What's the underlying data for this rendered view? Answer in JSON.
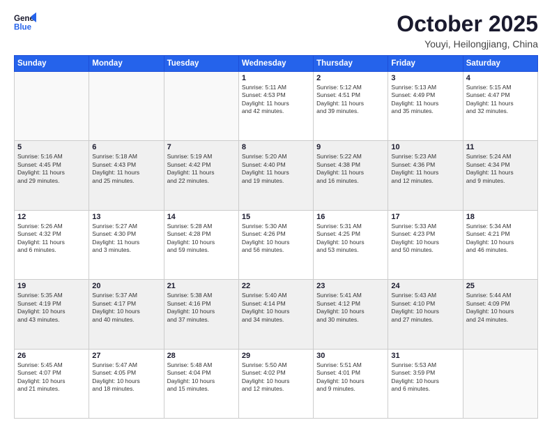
{
  "logo": {
    "line1": "General",
    "line2": "Blue"
  },
  "header": {
    "month": "October 2025",
    "location": "Youyi, Heilongjiang, China"
  },
  "weekdays": [
    "Sunday",
    "Monday",
    "Tuesday",
    "Wednesday",
    "Thursday",
    "Friday",
    "Saturday"
  ],
  "weeks": [
    [
      {
        "day": "",
        "info": ""
      },
      {
        "day": "",
        "info": ""
      },
      {
        "day": "",
        "info": ""
      },
      {
        "day": "1",
        "info": "Sunrise: 5:11 AM\nSunset: 4:53 PM\nDaylight: 11 hours\nand 42 minutes."
      },
      {
        "day": "2",
        "info": "Sunrise: 5:12 AM\nSunset: 4:51 PM\nDaylight: 11 hours\nand 39 minutes."
      },
      {
        "day": "3",
        "info": "Sunrise: 5:13 AM\nSunset: 4:49 PM\nDaylight: 11 hours\nand 35 minutes."
      },
      {
        "day": "4",
        "info": "Sunrise: 5:15 AM\nSunset: 4:47 PM\nDaylight: 11 hours\nand 32 minutes."
      }
    ],
    [
      {
        "day": "5",
        "info": "Sunrise: 5:16 AM\nSunset: 4:45 PM\nDaylight: 11 hours\nand 29 minutes."
      },
      {
        "day": "6",
        "info": "Sunrise: 5:18 AM\nSunset: 4:43 PM\nDaylight: 11 hours\nand 25 minutes."
      },
      {
        "day": "7",
        "info": "Sunrise: 5:19 AM\nSunset: 4:42 PM\nDaylight: 11 hours\nand 22 minutes."
      },
      {
        "day": "8",
        "info": "Sunrise: 5:20 AM\nSunset: 4:40 PM\nDaylight: 11 hours\nand 19 minutes."
      },
      {
        "day": "9",
        "info": "Sunrise: 5:22 AM\nSunset: 4:38 PM\nDaylight: 11 hours\nand 16 minutes."
      },
      {
        "day": "10",
        "info": "Sunrise: 5:23 AM\nSunset: 4:36 PM\nDaylight: 11 hours\nand 12 minutes."
      },
      {
        "day": "11",
        "info": "Sunrise: 5:24 AM\nSunset: 4:34 PM\nDaylight: 11 hours\nand 9 minutes."
      }
    ],
    [
      {
        "day": "12",
        "info": "Sunrise: 5:26 AM\nSunset: 4:32 PM\nDaylight: 11 hours\nand 6 minutes."
      },
      {
        "day": "13",
        "info": "Sunrise: 5:27 AM\nSunset: 4:30 PM\nDaylight: 11 hours\nand 3 minutes."
      },
      {
        "day": "14",
        "info": "Sunrise: 5:28 AM\nSunset: 4:28 PM\nDaylight: 10 hours\nand 59 minutes."
      },
      {
        "day": "15",
        "info": "Sunrise: 5:30 AM\nSunset: 4:26 PM\nDaylight: 10 hours\nand 56 minutes."
      },
      {
        "day": "16",
        "info": "Sunrise: 5:31 AM\nSunset: 4:25 PM\nDaylight: 10 hours\nand 53 minutes."
      },
      {
        "day": "17",
        "info": "Sunrise: 5:33 AM\nSunset: 4:23 PM\nDaylight: 10 hours\nand 50 minutes."
      },
      {
        "day": "18",
        "info": "Sunrise: 5:34 AM\nSunset: 4:21 PM\nDaylight: 10 hours\nand 46 minutes."
      }
    ],
    [
      {
        "day": "19",
        "info": "Sunrise: 5:35 AM\nSunset: 4:19 PM\nDaylight: 10 hours\nand 43 minutes."
      },
      {
        "day": "20",
        "info": "Sunrise: 5:37 AM\nSunset: 4:17 PM\nDaylight: 10 hours\nand 40 minutes."
      },
      {
        "day": "21",
        "info": "Sunrise: 5:38 AM\nSunset: 4:16 PM\nDaylight: 10 hours\nand 37 minutes."
      },
      {
        "day": "22",
        "info": "Sunrise: 5:40 AM\nSunset: 4:14 PM\nDaylight: 10 hours\nand 34 minutes."
      },
      {
        "day": "23",
        "info": "Sunrise: 5:41 AM\nSunset: 4:12 PM\nDaylight: 10 hours\nand 30 minutes."
      },
      {
        "day": "24",
        "info": "Sunrise: 5:43 AM\nSunset: 4:10 PM\nDaylight: 10 hours\nand 27 minutes."
      },
      {
        "day": "25",
        "info": "Sunrise: 5:44 AM\nSunset: 4:09 PM\nDaylight: 10 hours\nand 24 minutes."
      }
    ],
    [
      {
        "day": "26",
        "info": "Sunrise: 5:45 AM\nSunset: 4:07 PM\nDaylight: 10 hours\nand 21 minutes."
      },
      {
        "day": "27",
        "info": "Sunrise: 5:47 AM\nSunset: 4:05 PM\nDaylight: 10 hours\nand 18 minutes."
      },
      {
        "day": "28",
        "info": "Sunrise: 5:48 AM\nSunset: 4:04 PM\nDaylight: 10 hours\nand 15 minutes."
      },
      {
        "day": "29",
        "info": "Sunrise: 5:50 AM\nSunset: 4:02 PM\nDaylight: 10 hours\nand 12 minutes."
      },
      {
        "day": "30",
        "info": "Sunrise: 5:51 AM\nSunset: 4:01 PM\nDaylight: 10 hours\nand 9 minutes."
      },
      {
        "day": "31",
        "info": "Sunrise: 5:53 AM\nSunset: 3:59 PM\nDaylight: 10 hours\nand 6 minutes."
      },
      {
        "day": "",
        "info": ""
      }
    ]
  ]
}
